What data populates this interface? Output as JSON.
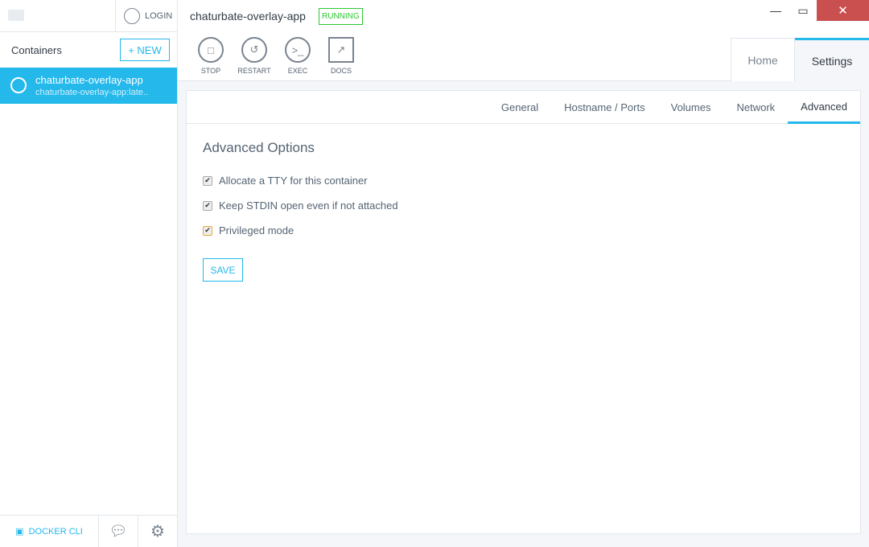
{
  "sidebar": {
    "login_label": "LOGIN",
    "containers_label": "Containers",
    "new_label": "+ NEW",
    "items": [
      {
        "name": "chaturbate-overlay-app",
        "image": "chaturbate-overlay-app:late.."
      }
    ],
    "docker_cli_label": "DOCKER CLI"
  },
  "header": {
    "title": "chaturbate-overlay-app",
    "status": "RUNNING",
    "status_color": "#2bc832",
    "actions": [
      {
        "label": "STOP",
        "icon": "stop-icon"
      },
      {
        "label": "RESTART",
        "icon": "restart-icon"
      },
      {
        "label": "EXEC",
        "icon": "terminal-icon"
      },
      {
        "label": "DOCS",
        "icon": "external-link-icon"
      }
    ],
    "tabs": [
      {
        "label": "Home"
      },
      {
        "label": "Settings",
        "active": true
      }
    ]
  },
  "settings": {
    "tabs": [
      {
        "label": "General"
      },
      {
        "label": "Hostname / Ports"
      },
      {
        "label": "Volumes"
      },
      {
        "label": "Network"
      },
      {
        "label": "Advanced",
        "active": true
      }
    ],
    "heading": "Advanced Options",
    "options": [
      {
        "label": "Allocate a TTY for this container",
        "checked": true
      },
      {
        "label": "Keep STDIN open even if not attached",
        "checked": true
      },
      {
        "label": "Privileged mode",
        "checked": true
      }
    ],
    "save_label": "SAVE"
  },
  "accent": "#24b8eb"
}
